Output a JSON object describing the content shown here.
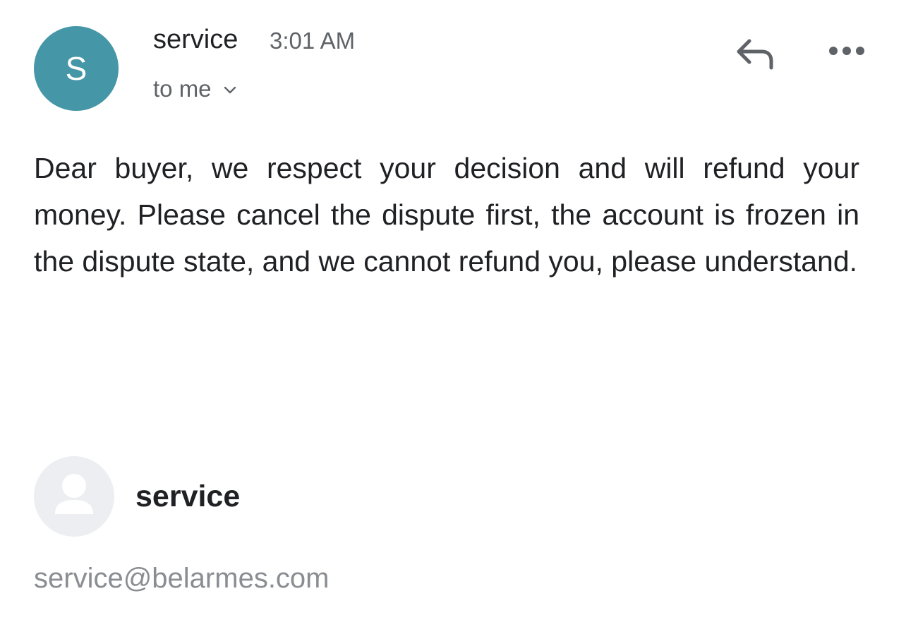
{
  "message": {
    "sender": {
      "initial": "S",
      "name": "service",
      "avatar_color": "#4596a7"
    },
    "time": "3:01 AM",
    "recipient": "to me",
    "icons": {
      "reply": "reply-icon",
      "more": "more-options-icon",
      "expand": "chevron-down-icon"
    },
    "body": "Dear buyer, we respect your decision and will refund your money. Please cancel the dispute first, the account is frozen in the dispute state, and we cannot refund you, please understand."
  },
  "signature": {
    "name": "service",
    "email": "service@belarmes.com",
    "avatar_icon": "person-icon"
  }
}
